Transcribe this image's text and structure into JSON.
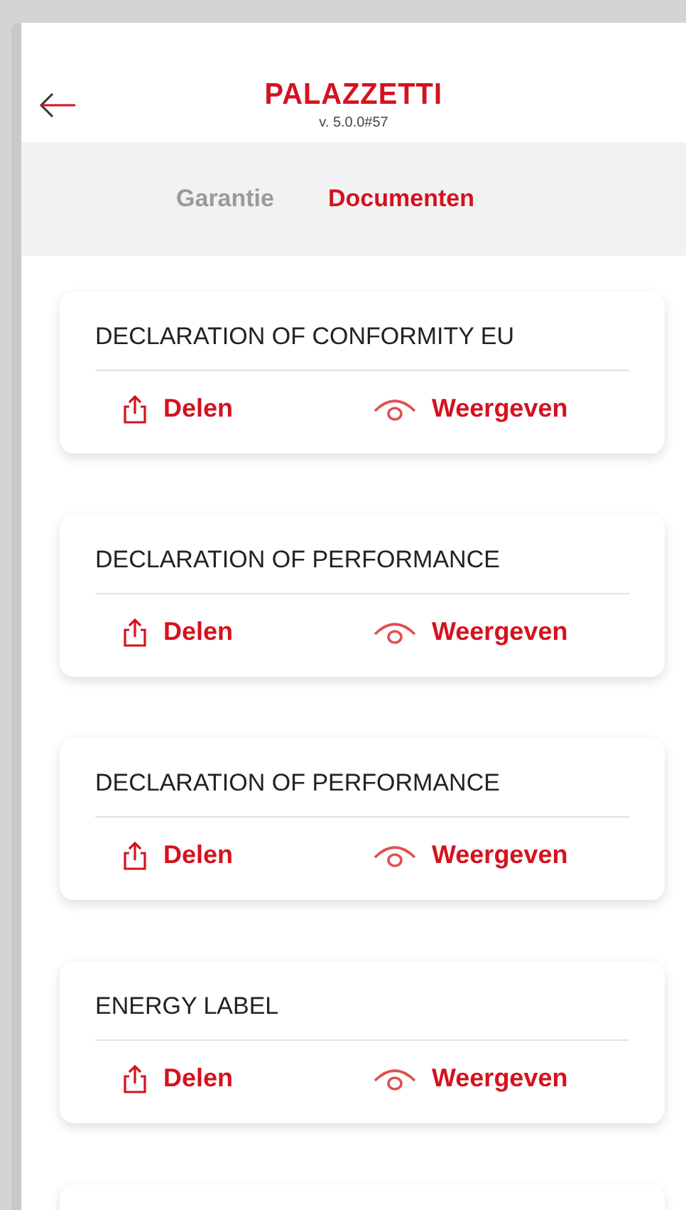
{
  "header": {
    "logo": "PALAZZETTI",
    "version": "v. 5.0.0#57"
  },
  "tabs": [
    {
      "label": "Garantie",
      "selected": false
    },
    {
      "label": "Documenten",
      "selected": true
    }
  ],
  "documents": [
    {
      "title": "DECLARATION OF CONFORMITY EU",
      "share": "Delen",
      "view": "Weergeven"
    },
    {
      "title": "DECLARATION OF PERFORMANCE",
      "share": "Delen",
      "view": "Weergeven"
    },
    {
      "title": "DECLARATION OF PERFORMANCE",
      "share": "Delen",
      "view": "Weergeven"
    },
    {
      "title": "ENERGY LABEL",
      "share": "Delen",
      "view": "Weergeven"
    }
  ]
}
